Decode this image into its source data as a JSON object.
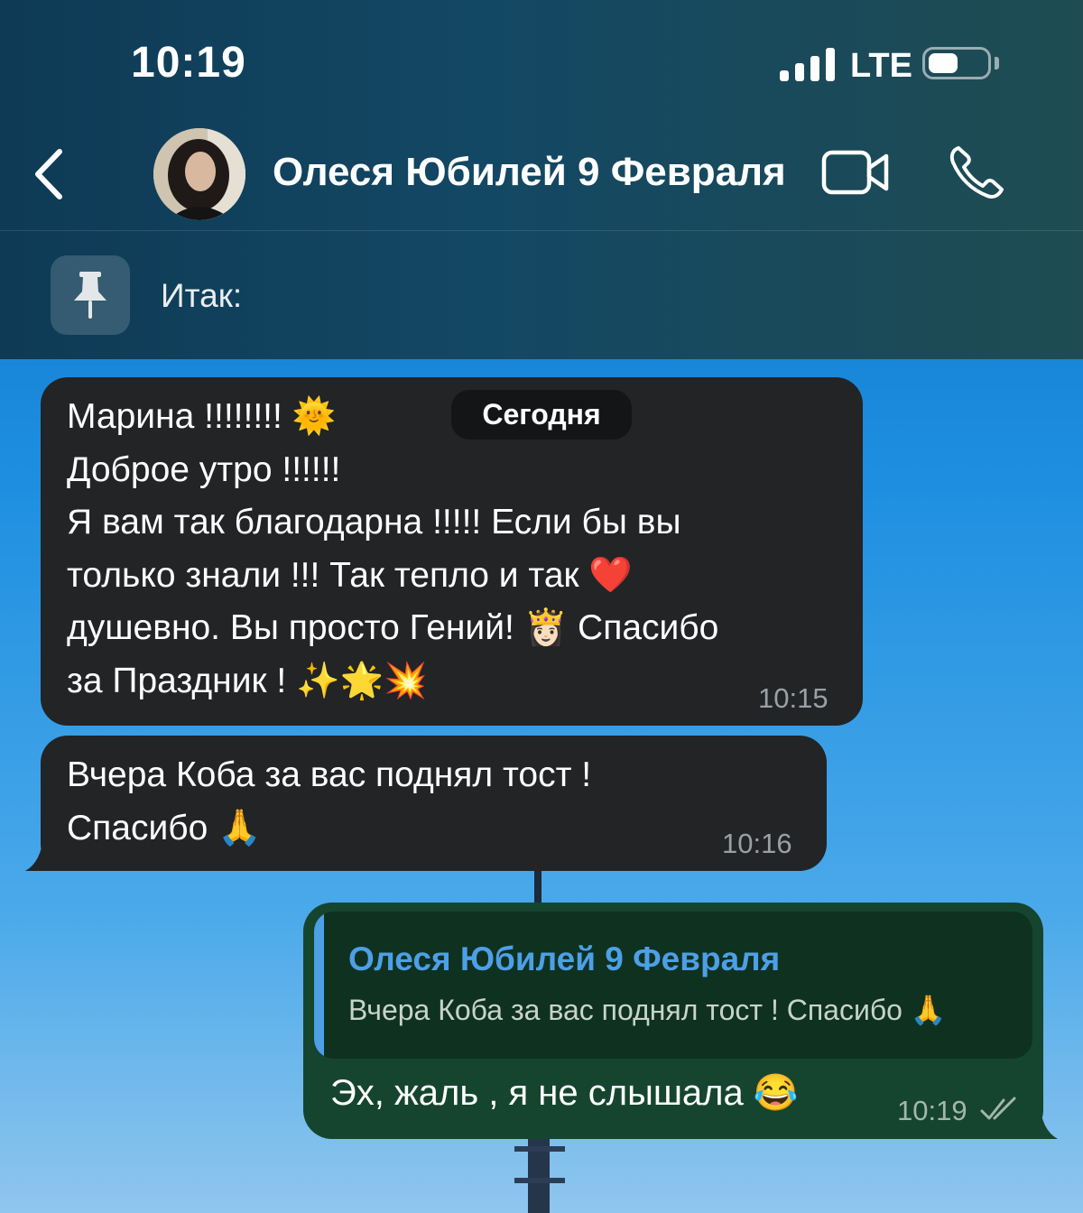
{
  "status_bar": {
    "time": "10:19",
    "network": "LTE"
  },
  "header": {
    "contact_name": "Олеся Юбилей 9 Февраля",
    "back_icon": "chevron-left-icon",
    "video_icon": "video-camera-icon",
    "call_icon": "phone-icon"
  },
  "pinned": {
    "icon": "pin-icon",
    "text": "Итак:"
  },
  "date_chip": "Сегодня",
  "messages": [
    {
      "direction": "incoming",
      "text": "Марина !!!!!!!! 🌞\nДоброе утро !!!!!!\nЯ вам так благодарна !!!!! Если бы вы\nтолько знали !!! Так тепло и так ❤️\nдушевно. Вы просто Гений! 👸🏻 Спасибо\nза Праздник ! ✨🌟💥",
      "time": "10:15"
    },
    {
      "direction": "incoming",
      "text": "Вчера Коба за вас поднял тост !\nСпасибо 🙏",
      "time": "10:16"
    },
    {
      "direction": "outgoing",
      "reply_to": {
        "name": "Олеся Юбилей 9 Февраля",
        "text": "Вчера Коба за вас поднял тост ! Спасибо 🙏"
      },
      "text": "Эх, жаль , я не слышала 😂",
      "time": "10:19",
      "status": "read"
    }
  ],
  "colors": {
    "incoming_bubble": "#222426",
    "outgoing_bubble": "#16452f",
    "quote_accent": "#4d9fe6"
  }
}
